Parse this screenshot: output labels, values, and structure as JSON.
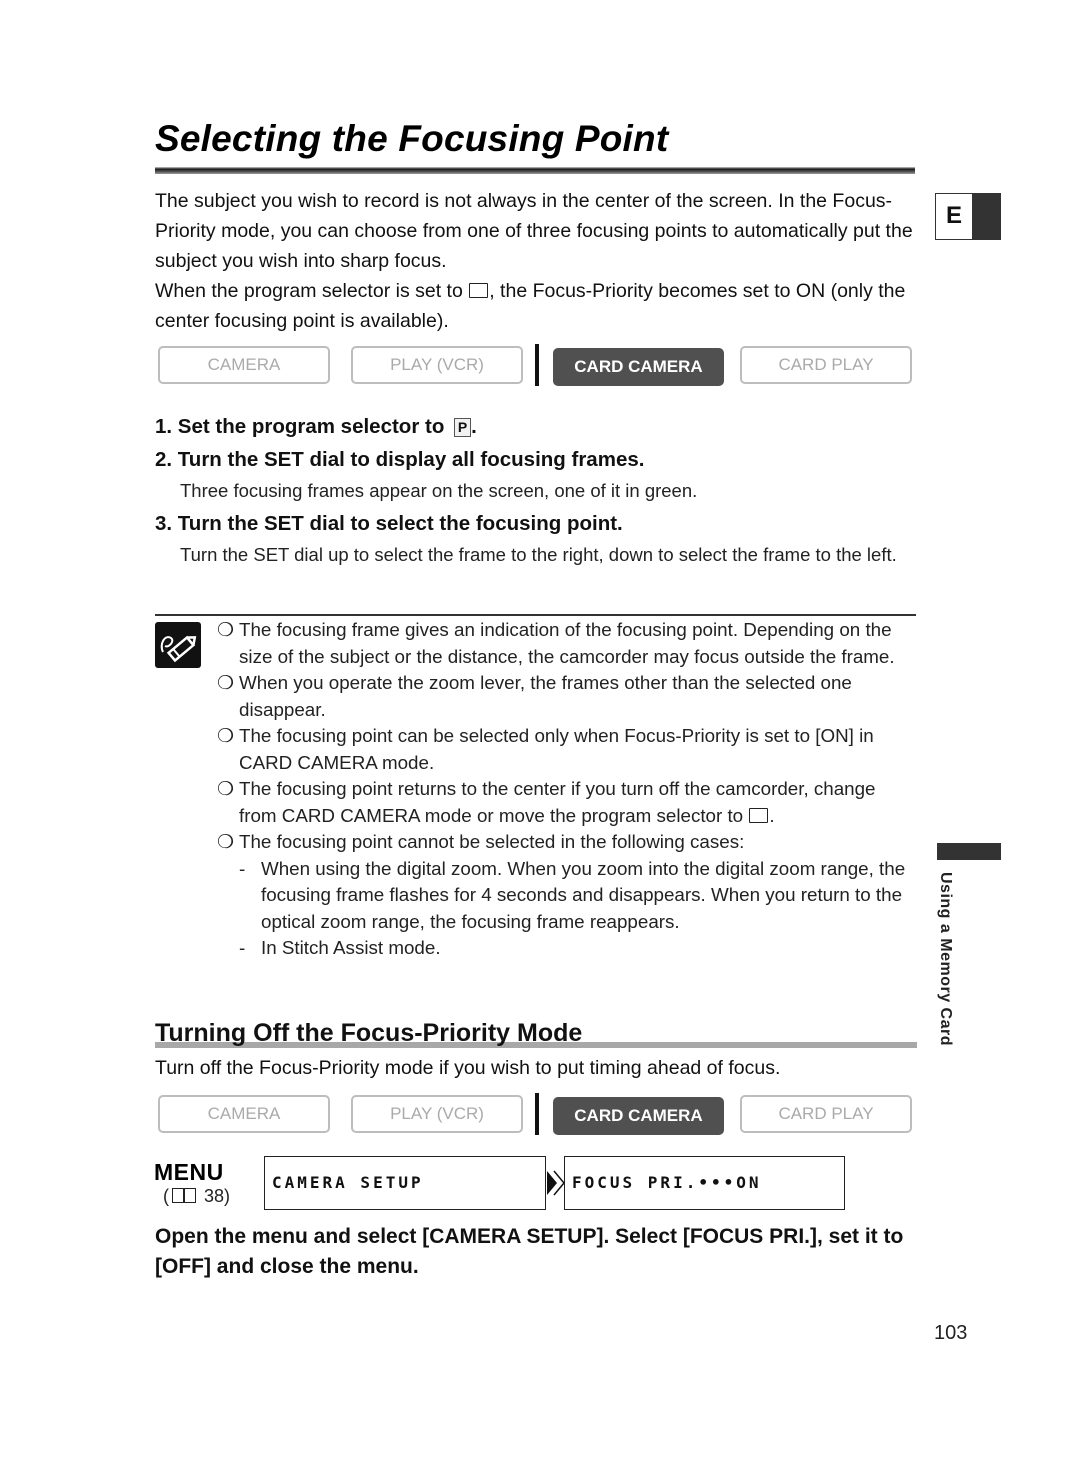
{
  "page": {
    "title": "Selecting the Focusing Point",
    "language_tab": "E",
    "side_label": "Using a Memory Card",
    "page_number": "103"
  },
  "intro": {
    "paragraph1": "The subject you wish to record is not always in the center of the screen. In the Focus-Priority mode, you can choose from one of three focusing points to automatically put the subject you wish into sharp focus.",
    "paragraph2_before": "When the program selector is set to ",
    "paragraph2_icon": "auto-mode-box-icon",
    "paragraph2_after": ", the Focus-Priority becomes set to ON (only the center focusing point is available)."
  },
  "mode_bar_1": {
    "modes": [
      {
        "label": "CAMERA",
        "active": false
      },
      {
        "label": "PLAY (VCR)",
        "active": false
      },
      {
        "label": "CARD CAMERA",
        "active": true
      },
      {
        "label": "CARD PLAY",
        "active": false
      }
    ]
  },
  "steps": [
    {
      "heading_before": "1. Set the program selector to ",
      "heading_icon_text": "P",
      "heading_after": ".",
      "detail": ""
    },
    {
      "heading": "2. Turn the SET dial to display all focusing frames.",
      "detail": "Three focusing frames appear on the screen, one of it in green."
    },
    {
      "heading": "3. Turn the SET dial to select the focusing point.",
      "detail": "Turn the SET dial up to select the frame to the right, down to select the frame to the left."
    }
  ],
  "notes": {
    "icon": "pencil-note-icon",
    "bullet": "❍",
    "items": [
      {
        "text": "The focusing frame gives an indication of the focusing point. Depending on the size of the subject or the distance, the camcorder may focus outside the frame."
      },
      {
        "text": "When you operate the zoom lever, the frames other than the selected one disappear."
      },
      {
        "text": "The focusing point can be selected only when Focus-Priority is set to [ON] in CARD CAMERA mode."
      },
      {
        "text_before": "The focusing point returns to the center if you turn off the camcorder, change from CARD CAMERA mode or move the program selector to ",
        "text_after": "."
      },
      {
        "text": "The focusing point cannot be selected in the following cases:"
      }
    ],
    "subitems": [
      {
        "dash": "-",
        "text": "When using the digital zoom. When you zoom into the digital zoom range, the focusing frame flashes for 4 seconds and disappears. When you return to the optical zoom range, the focusing frame reappears."
      },
      {
        "dash": "-",
        "text": "In Stitch Assist mode."
      }
    ]
  },
  "section2": {
    "title": "Turning Off the Focus-Priority Mode",
    "text": "Turn off the Focus-Priority mode if you wish to put timing ahead of focus."
  },
  "mode_bar_2": {
    "modes": [
      {
        "label": "CAMERA",
        "active": false
      },
      {
        "label": "PLAY (VCR)",
        "active": false
      },
      {
        "label": "CARD CAMERA",
        "active": true
      },
      {
        "label": "CARD PLAY",
        "active": false
      }
    ]
  },
  "menu": {
    "label": "MENU",
    "ref_open": "(",
    "ref_page": " 38)",
    "screen1": "CAMERA SETUP",
    "screen2": "FOCUS PRI.•••ON"
  },
  "final_instruction": "Open the menu and select [CAMERA SETUP]. Select [FOCUS PRI.], set it to [OFF] and close the menu."
}
